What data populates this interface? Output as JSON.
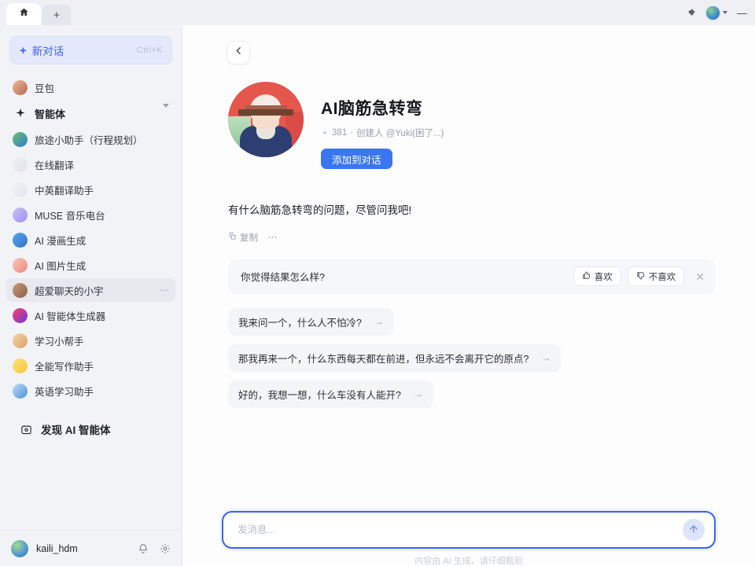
{
  "titlebar": {
    "home_tab_icon": "home-icon",
    "new_tab_label": "+",
    "pin_icon": "pin-icon",
    "minimize_label": "—"
  },
  "sidebar": {
    "new_chat": {
      "label": "新对话",
      "plus": "+",
      "shortcut": "Ctrl+K"
    },
    "primary": {
      "label": "豆包",
      "icon": "doubao-avatar-icon"
    },
    "section": {
      "label": "智能体",
      "icon": "sparkle-icon",
      "chevron": "chevron-down-icon"
    },
    "agents": [
      {
        "label": "旅途小助手（行程规划）",
        "icon": "travel-icon",
        "color1": "#6dbf6a",
        "color2": "#2f7fd0"
      },
      {
        "label": "在线翻译",
        "icon": "translate-icon",
        "color1": "#eef0f4",
        "color2": "#dfe3ea"
      },
      {
        "label": "中英翻译助手",
        "icon": "cn-en-icon",
        "color1": "#f1f2f6",
        "color2": "#e2e5ec"
      },
      {
        "label": "MUSE 音乐电台",
        "icon": "music-icon",
        "color1": "#c9c3f8",
        "color2": "#9b8ef0"
      },
      {
        "label": "AI 漫画生成",
        "icon": "comic-icon",
        "color1": "#5aa9e8",
        "color2": "#2f6fd0"
      },
      {
        "label": "AI 图片生成",
        "icon": "image-gen-icon",
        "color1": "#f8c6c0",
        "color2": "#ef8a7a"
      },
      {
        "label": "超爱聊天的小宇",
        "icon": "girl-avatar-icon",
        "color1": "#c99a7a",
        "color2": "#8c6046",
        "active": true,
        "more": "⋯"
      },
      {
        "label": "AI 智能体生成器",
        "icon": "agent-builder-icon",
        "color1": "#ff3d6e",
        "color2": "#6a3bd6"
      },
      {
        "label": "学习小帮手",
        "icon": "study-helper-icon",
        "color1": "#f6d7a8",
        "color2": "#d9a066"
      },
      {
        "label": "全能写作助手",
        "icon": "writing-icon",
        "color1": "#ffe27a",
        "color2": "#f6c63c"
      },
      {
        "label": "英语学习助手",
        "icon": "english-icon",
        "color1": "#bfe1f7",
        "color2": "#4d8fd0"
      }
    ],
    "discover": {
      "label": "发现 AI 智能体",
      "icon": "discover-icon"
    },
    "footer": {
      "username": "kaili_hdm",
      "bell_icon": "bell-icon",
      "settings_icon": "gear-icon"
    }
  },
  "main": {
    "back_icon": "chevron-left-icon",
    "profile": {
      "avatar": "bot-avatar-icon",
      "title": "AI脑筋急转弯",
      "fire_icon": "fire-icon",
      "likes": "381",
      "separator": "·",
      "creator": "创建人 @Yuki(困了...)",
      "add_button": "添加到对话"
    },
    "bot_message": "有什么脑筋急转弯的问题，尽管问我吧!",
    "tools": {
      "copy_label": "复制",
      "copy_icon": "copy-icon",
      "more_icon": "more-dots-icon"
    },
    "feedback": {
      "question": "你觉得结果怎么样?",
      "like_label": "喜欢",
      "like_icon": "thumbs-up-icon",
      "dislike_label": "不喜欢",
      "dislike_icon": "thumbs-down-icon",
      "close_icon": "close-icon"
    },
    "suggestions": [
      {
        "text": "我来问一个，什么人不怕冷?",
        "arrow": "→"
      },
      {
        "text": "那我再来一个，什么东西每天都在前进，但永远不会离开它的原点?",
        "arrow": "→"
      },
      {
        "text": "好的，我想一想，什么车没有人能开?",
        "arrow": "→"
      }
    ],
    "composer": {
      "placeholder": "发消息...",
      "value": "",
      "send_icon": "send-arrow-icon"
    },
    "disclaimer": "内容由 AI 生成，请仔细甄别"
  },
  "colors": {
    "accent": "#3a63f2",
    "button_blue": "#3a76f0",
    "sidebar_bg": "#f2f3f7",
    "chip_bg": "#f4f5f7"
  }
}
